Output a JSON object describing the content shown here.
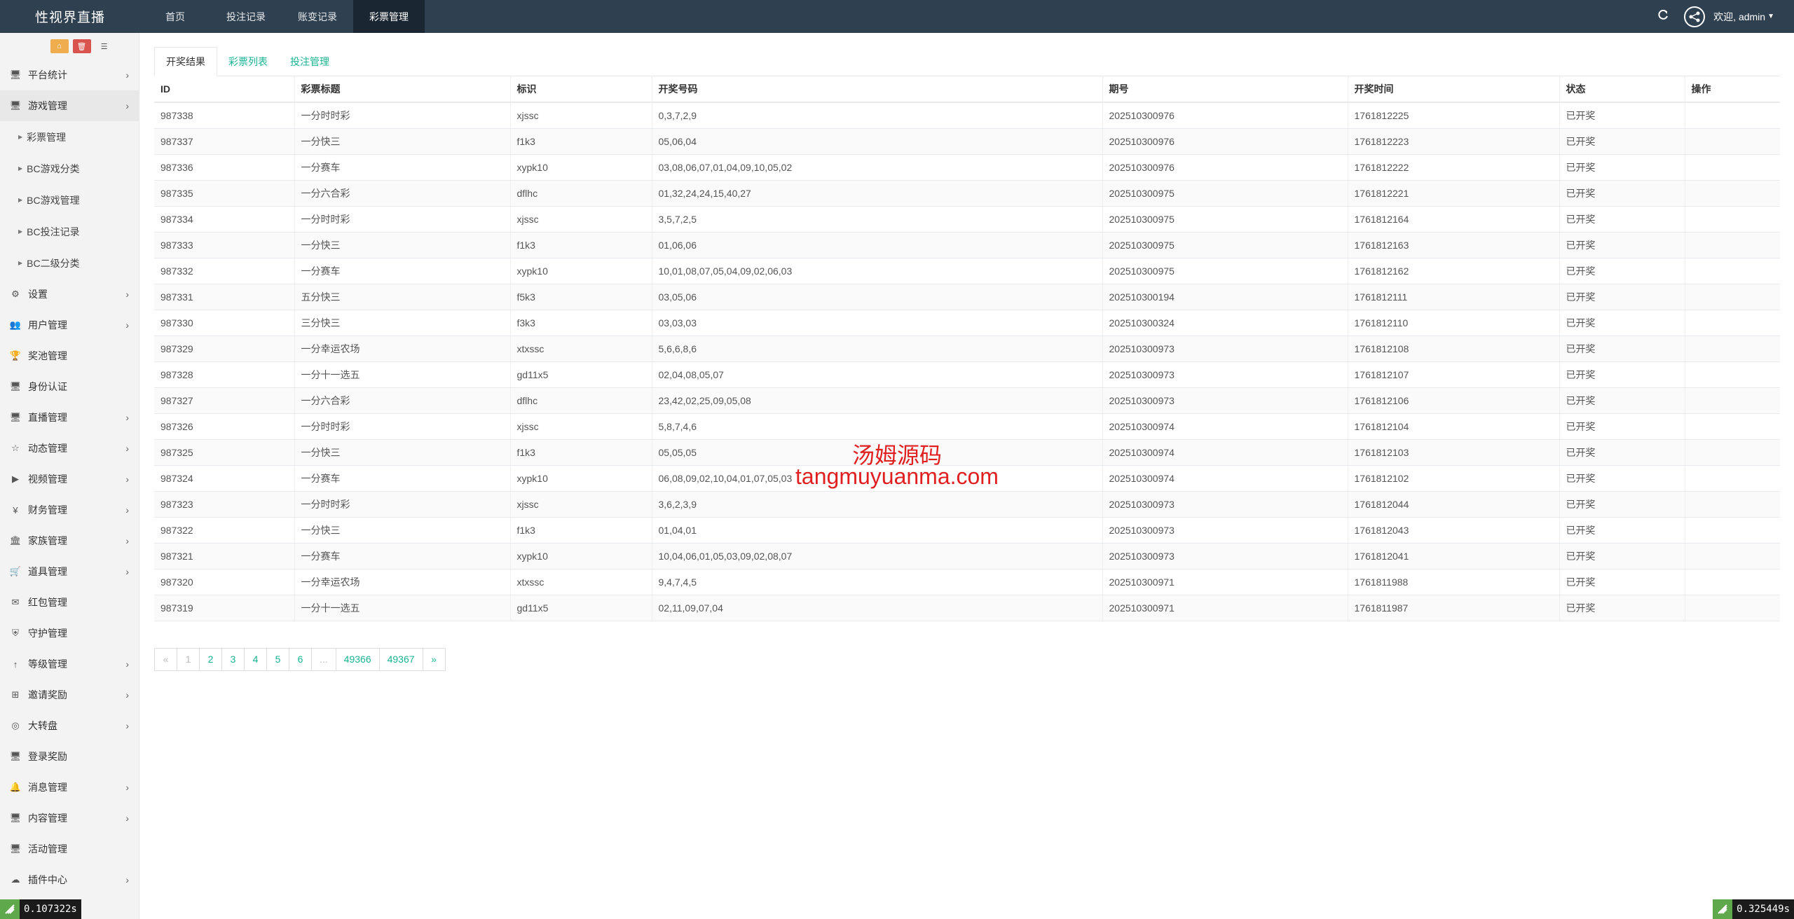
{
  "brand": "性视界直播",
  "topnav": [
    "首页",
    "投注记录",
    "账变记录",
    "彩票管理"
  ],
  "user": {
    "welcome": "欢迎, admin"
  },
  "sidebar": {
    "items": [
      {
        "label": "平台统计",
        "icon": "monitor-icon",
        "chevron": true
      },
      {
        "label": "游戏管理",
        "icon": "monitor-icon",
        "chevron": true,
        "open": true,
        "children": [
          "彩票管理",
          "BC游戏分类",
          "BC游戏管理",
          "BC投注记录",
          "BC二级分类"
        ]
      },
      {
        "label": "设置",
        "icon": "gears-icon",
        "chevron": true
      },
      {
        "label": "用户管理",
        "icon": "users-icon",
        "chevron": true
      },
      {
        "label": "奖池管理",
        "icon": "trophy-icon",
        "chevron": false
      },
      {
        "label": "身份认证",
        "icon": "monitor-icon",
        "chevron": false
      },
      {
        "label": "直播管理",
        "icon": "monitor-icon",
        "chevron": true
      },
      {
        "label": "动态管理",
        "icon": "star-icon",
        "chevron": true
      },
      {
        "label": "视频管理",
        "icon": "video-icon",
        "chevron": true
      },
      {
        "label": "财务管理",
        "icon": "yen-icon",
        "chevron": true
      },
      {
        "label": "家族管理",
        "icon": "bank-icon",
        "chevron": true
      },
      {
        "label": "道具管理",
        "icon": "cart-icon",
        "chevron": true
      },
      {
        "label": "红包管理",
        "icon": "envelope-icon",
        "chevron": false
      },
      {
        "label": "守护管理",
        "icon": "shield-icon",
        "chevron": false
      },
      {
        "label": "等级管理",
        "icon": "level-up-icon",
        "chevron": true
      },
      {
        "label": "邀请奖励",
        "icon": "sitemap-icon",
        "chevron": true
      },
      {
        "label": "大转盘",
        "icon": "gamepad-icon",
        "chevron": true
      },
      {
        "label": "登录奖励",
        "icon": "monitor-icon",
        "chevron": false
      },
      {
        "label": "消息管理",
        "icon": "bell-icon",
        "chevron": true
      },
      {
        "label": "内容管理",
        "icon": "monitor-icon",
        "chevron": true
      },
      {
        "label": "活动管理",
        "icon": "monitor-icon",
        "chevron": false
      },
      {
        "label": "插件中心",
        "icon": "cloud-icon",
        "chevron": true
      }
    ]
  },
  "tabs": [
    "开奖结果",
    "彩票列表",
    "投注管理"
  ],
  "table": {
    "headers": [
      "ID",
      "彩票标题",
      "标识",
      "开奖号码",
      "期号",
      "开奖时间",
      "状态",
      "操作"
    ],
    "rows": [
      [
        "987338",
        "一分时时彩",
        "xjssc",
        "0,3,7,2,9",
        "202510300976",
        "1761812225",
        "已开奖",
        ""
      ],
      [
        "987337",
        "一分快三",
        "f1k3",
        "05,06,04",
        "202510300976",
        "1761812223",
        "已开奖",
        ""
      ],
      [
        "987336",
        "一分赛车",
        "xypk10",
        "03,08,06,07,01,04,09,10,05,02",
        "202510300976",
        "1761812222",
        "已开奖",
        ""
      ],
      [
        "987335",
        "一分六合彩",
        "dflhc",
        "01,32,24,24,15,40,27",
        "202510300975",
        "1761812221",
        "已开奖",
        ""
      ],
      [
        "987334",
        "一分时时彩",
        "xjssc",
        "3,5,7,2,5",
        "202510300975",
        "1761812164",
        "已开奖",
        ""
      ],
      [
        "987333",
        "一分快三",
        "f1k3",
        "01,06,06",
        "202510300975",
        "1761812163",
        "已开奖",
        ""
      ],
      [
        "987332",
        "一分赛车",
        "xypk10",
        "10,01,08,07,05,04,09,02,06,03",
        "202510300975",
        "1761812162",
        "已开奖",
        ""
      ],
      [
        "987331",
        "五分快三",
        "f5k3",
        "03,05,06",
        "202510300194",
        "1761812111",
        "已开奖",
        ""
      ],
      [
        "987330",
        "三分快三",
        "f3k3",
        "03,03,03",
        "202510300324",
        "1761812110",
        "已开奖",
        ""
      ],
      [
        "987329",
        "一分幸运农场",
        "xtxssc",
        "5,6,6,8,6",
        "202510300973",
        "1761812108",
        "已开奖",
        ""
      ],
      [
        "987328",
        "一分十一选五",
        "gd11x5",
        "02,04,08,05,07",
        "202510300973",
        "1761812107",
        "已开奖",
        ""
      ],
      [
        "987327",
        "一分六合彩",
        "dflhc",
        "23,42,02,25,09,05,08",
        "202510300973",
        "1761812106",
        "已开奖",
        ""
      ],
      [
        "987326",
        "一分时时彩",
        "xjssc",
        "5,8,7,4,6",
        "202510300974",
        "1761812104",
        "已开奖",
        ""
      ],
      [
        "987325",
        "一分快三",
        "f1k3",
        "05,05,05",
        "202510300974",
        "1761812103",
        "已开奖",
        ""
      ],
      [
        "987324",
        "一分赛车",
        "xypk10",
        "06,08,09,02,10,04,01,07,05,03",
        "202510300974",
        "1761812102",
        "已开奖",
        ""
      ],
      [
        "987323",
        "一分时时彩",
        "xjssc",
        "3,6,2,3,9",
        "202510300973",
        "1761812044",
        "已开奖",
        ""
      ],
      [
        "987322",
        "一分快三",
        "f1k3",
        "01,04,01",
        "202510300973",
        "1761812043",
        "已开奖",
        ""
      ],
      [
        "987321",
        "一分赛车",
        "xypk10",
        "10,04,06,01,05,03,09,02,08,07",
        "202510300973",
        "1761812041",
        "已开奖",
        ""
      ],
      [
        "987320",
        "一分幸运农场",
        "xtxssc",
        "9,4,7,4,5",
        "202510300971",
        "1761811988",
        "已开奖",
        ""
      ],
      [
        "987319",
        "一分十一选五",
        "gd11x5",
        "02,11,09,07,04",
        "202510300971",
        "1761811987",
        "已开奖",
        ""
      ]
    ]
  },
  "pagination": [
    "«",
    "1",
    "2",
    "3",
    "4",
    "5",
    "6",
    "...",
    "49366",
    "49367",
    "»"
  ],
  "watermark": {
    "cn": "汤姆源码",
    "en": "tangmuyuanma.com"
  },
  "timing": {
    "left": "0.107322s",
    "right": "0.325449s"
  },
  "colors": {
    "navbar": "#2f4050",
    "accent": "#1ab394",
    "sidebar": "#f3f3f4",
    "watermark": "#e02020"
  }
}
